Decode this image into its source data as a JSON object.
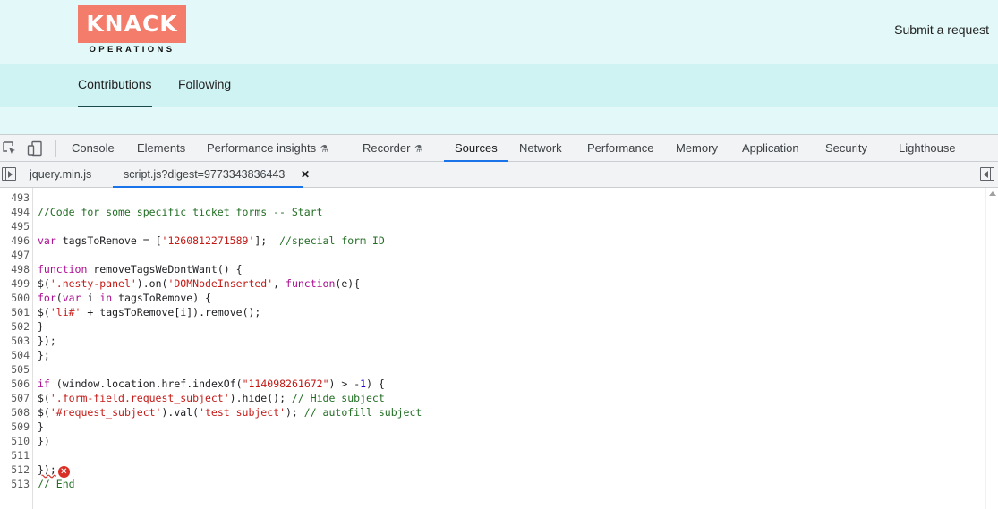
{
  "site": {
    "logo_text": "KNACK",
    "logo_subtext": "OPERATIONS",
    "submit_link": "Submit a request",
    "tabs": [
      {
        "label": "Contributions",
        "active": true
      },
      {
        "label": "Following",
        "active": false
      }
    ],
    "colors": {
      "header_bg": "#e3f8f8",
      "subnav_bg": "#cff2f2",
      "logo_bg": "#f47c6b"
    }
  },
  "devtools": {
    "icons": [
      "inspect-element-icon",
      "device-toolbar-icon"
    ],
    "tabs": [
      {
        "label": "Console"
      },
      {
        "label": "Elements"
      },
      {
        "label": "Performance insights",
        "experimental": true
      },
      {
        "label": "Recorder",
        "experimental": true
      },
      {
        "label": "Sources",
        "active": true
      },
      {
        "label": "Network"
      },
      {
        "label": "Performance"
      },
      {
        "label": "Memory"
      },
      {
        "label": "Application"
      },
      {
        "label": "Security"
      },
      {
        "label": "Lighthouse"
      }
    ],
    "flask_glyph": "⚗",
    "file_tabs": [
      {
        "label": "jquery.min.js",
        "active": false
      },
      {
        "label": "script.js?digest=9773343836443",
        "active": true,
        "closable": true
      }
    ],
    "close_glyph": "✕",
    "error_glyph": "✕",
    "accent": "#1a73e8"
  },
  "code": {
    "lines": [
      {
        "num": "493",
        "text": ""
      },
      {
        "num": "494",
        "text": "//Code for some specific ticket forms -- Start"
      },
      {
        "num": "495",
        "text": ""
      },
      {
        "num": "496",
        "text": "var tagsToRemove = ['1260812271589'];  //special form ID"
      },
      {
        "num": "497",
        "text": ""
      },
      {
        "num": "498",
        "text": "function removeTagsWeDontWant() {"
      },
      {
        "num": "499",
        "text": "$('.nesty-panel').on('DOMNodeInserted', function(e){"
      },
      {
        "num": "500",
        "text": "for(var i in tagsToRemove) {"
      },
      {
        "num": "501",
        "text": "$('li#' + tagsToRemove[i]).remove();"
      },
      {
        "num": "502",
        "text": "}"
      },
      {
        "num": "503",
        "text": "});"
      },
      {
        "num": "504",
        "text": "};"
      },
      {
        "num": "505",
        "text": ""
      },
      {
        "num": "506",
        "text": "if (window.location.href.indexOf(\"114098261672\") > -1) {"
      },
      {
        "num": "507",
        "text": "$('.form-field.request_subject').hide(); // Hide subject"
      },
      {
        "num": "508",
        "text": "$('#request_subject').val('test subject'); // autofill subject"
      },
      {
        "num": "509",
        "text": "}"
      },
      {
        "num": "510",
        "text": "})"
      },
      {
        "num": "511",
        "text": ""
      },
      {
        "num": "512",
        "text": "});",
        "error": true
      },
      {
        "num": "513",
        "text": "// End"
      }
    ]
  }
}
